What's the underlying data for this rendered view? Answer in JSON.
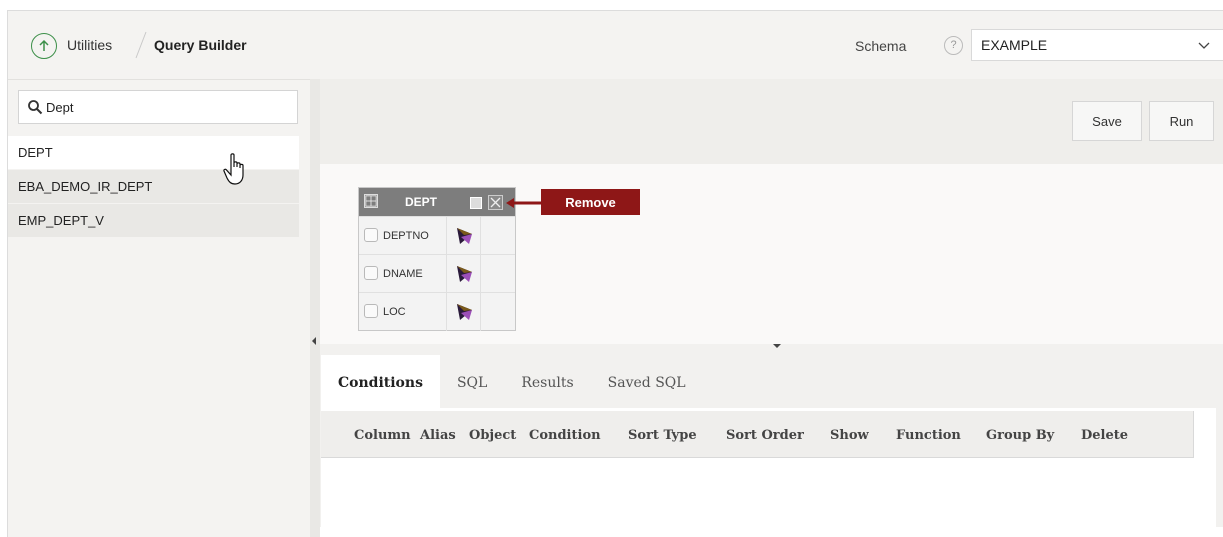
{
  "header": {
    "breadcrumb_parent": "Utilities",
    "breadcrumb_current": "Query Builder",
    "schema_label": "Schema",
    "schema_value": "EXAMPLE"
  },
  "left": {
    "search_value": "Dept",
    "tables": [
      "DEPT",
      "EBA_DEMO_IR_DEPT",
      "EMP_DEPT_V"
    ]
  },
  "toolbar": {
    "save_label": "Save",
    "run_label": "Run"
  },
  "dept_table": {
    "title": "DEPT",
    "columns": [
      "DEPTNO",
      "DNAME",
      "LOC"
    ]
  },
  "callout": {
    "remove_label": "Remove",
    "color": "#8e1717"
  },
  "tabs": [
    "Conditions",
    "SQL",
    "Results",
    "Saved SQL"
  ],
  "conditions": {
    "columns": [
      "Column",
      "Alias",
      "Object",
      "Condition",
      "Sort Type",
      "Sort Order",
      "Show",
      "Function",
      "Group By",
      "Delete"
    ]
  },
  "colors": {
    "accent_green": "#3c8f49"
  }
}
